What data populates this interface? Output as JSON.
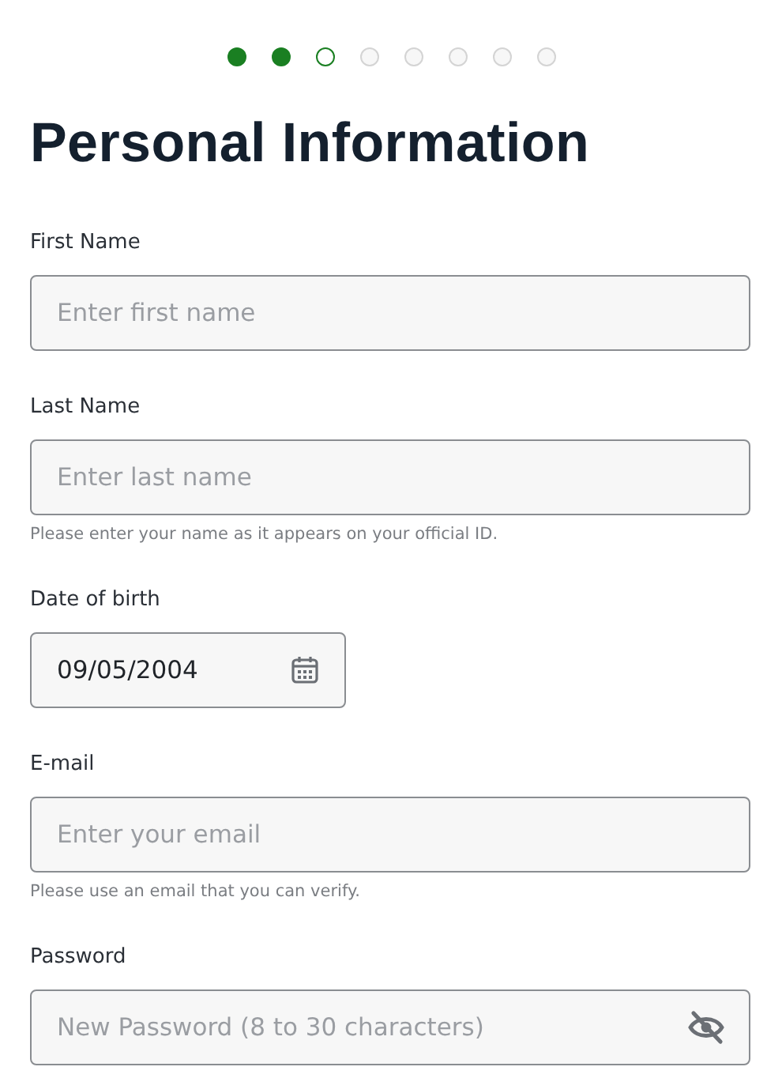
{
  "steps": [
    {
      "completed": true,
      "selected": false
    },
    {
      "completed": true,
      "selected": false
    },
    {
      "completed": false,
      "selected": true
    },
    {
      "completed": false,
      "selected": false
    },
    {
      "completed": false,
      "selected": false
    },
    {
      "completed": false,
      "selected": false
    },
    {
      "completed": false,
      "selected": false
    },
    {
      "completed": false,
      "selected": false
    }
  ],
  "title": "Personal Information",
  "fields": [
    {
      "kind": "text",
      "label": "First Name",
      "placeholder": "Enter first name"
    },
    {
      "kind": "text",
      "label": "Last Name",
      "placeholder": "Enter last name",
      "hint": "Please enter your name as it appears on your official ID."
    },
    {
      "kind": "date",
      "label": "Date of birth",
      "value": "09/05/2004"
    },
    {
      "kind": "text",
      "label": "E-mail",
      "placeholder": "Enter your email",
      "hint": "Please use an email that you can verify."
    },
    {
      "kind": "password",
      "label": "Password",
      "placeholder": "New Password (8 to 30 characters)"
    }
  ]
}
